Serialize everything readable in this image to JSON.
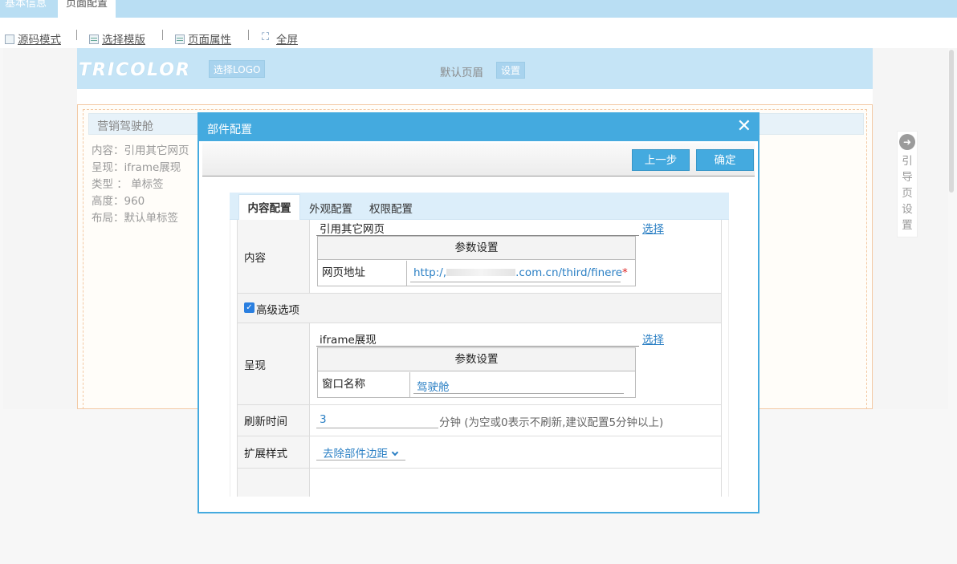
{
  "top_tabs": [
    "基本信息",
    "页面配置"
  ],
  "toolbar": {
    "source_mode": "源码模式",
    "select_template": "选择模版",
    "page_props": "页面属性",
    "fullscreen": "全屏"
  },
  "header": {
    "logo_text": "TRICOLOR",
    "select_logo": "选择LOGO",
    "default_header": "默认页眉",
    "set": "设置"
  },
  "panel": {
    "title": "营销驾驶舱",
    "lines": [
      "内容：引用其它网页",
      "呈现：iframe展现",
      "类型 ： 单标签",
      "高度：960",
      "布局：默认单标签"
    ]
  },
  "guide": {
    "chars": [
      "引",
      "导",
      "页",
      "设",
      "置"
    ]
  },
  "modal": {
    "title": "部件配置",
    "close": "╳",
    "prev": "上一步",
    "ok": "确定",
    "tabs": [
      "内容配置",
      "外观配置",
      "权限配置"
    ],
    "content_row": {
      "label": "内容",
      "value": "引用其它网页",
      "select": "选择",
      "param_header": "参数设置",
      "param_label": "网页地址",
      "url_prefix": "http:/,",
      "url_suffix": ".com.cn/third/finere",
      "required": "*"
    },
    "advanced": "高级选项",
    "present_row": {
      "label": "呈现",
      "value": "iframe展现",
      "select": "选择",
      "param_header": "参数设置",
      "param_label": "窗口名称",
      "param_value": "驾驶舱"
    },
    "refresh_row": {
      "label": "刷新时间",
      "value": "3",
      "hint": "分钟 (为空或0表示不刷新,建议配置5分钟以上)"
    },
    "ext_row": {
      "label": "扩展样式",
      "selected": "去除部件边距"
    }
  }
}
